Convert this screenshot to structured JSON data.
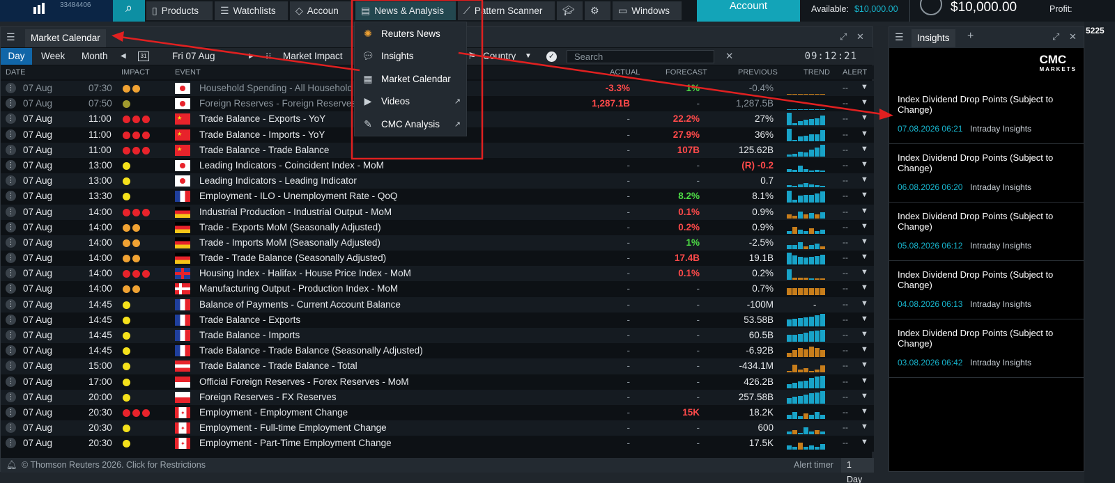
{
  "topnav": {
    "account_number": "33484406",
    "products": "Products",
    "watchlists": "Watchlists",
    "accounts": "Accoun",
    "news_analysis": "News & Analysis",
    "pattern_scanner": "Pattern Scanner",
    "windows": "Windows",
    "account": "Account",
    "available_label": "Available:",
    "available_value": "$10,000.00",
    "balance": "$10,000.00",
    "profit_label": "Profit:"
  },
  "dropdown": {
    "items": [
      {
        "label": "Reuters News",
        "icon": "reuters-icon"
      },
      {
        "label": "Insights",
        "icon": "insights-icon"
      },
      {
        "label": "Market Calendar",
        "icon": "calendar-icon"
      },
      {
        "label": "Videos",
        "icon": "video-icon",
        "external": true
      },
      {
        "label": "CMC Analysis",
        "icon": "pencil-icon",
        "external": true
      }
    ]
  },
  "calendar": {
    "tab": "Market Calendar",
    "views": [
      "Day",
      "Week",
      "Month"
    ],
    "date": "Fri 07 Aug",
    "date_icon_text": "31",
    "impact_filter": "Market Impact",
    "country_filter": "Country",
    "search_placeholder": "Search",
    "clock": "09:12:21",
    "columns": {
      "date": "DATE",
      "impact": "IMPACT",
      "event": "EVENT",
      "actual": "ACTUAL",
      "forecast": "FORECAST",
      "previous": "PREVIOUS",
      "trend": "TREND",
      "alert": "ALERT"
    },
    "footer": "© Thomson Reuters 2026. Click for Restrictions",
    "alert_timer": "Alert timer",
    "alert_timer_value": "1 Day ▲",
    "colors": {
      "high": "#e8232b",
      "medium": "#f0a233",
      "low": "#f5e11b",
      "low_dim": "#a09a2e",
      "trend_blue": "#18a3c8",
      "trend_orange": "#c77d1b"
    },
    "rows": [
      {
        "date": "07 Aug",
        "time": "07:30",
        "impact": [
          "medium",
          "medium"
        ],
        "flag": "jp",
        "event": "Household Spending - All Household Spending - YoY",
        "actual": "-3.3%",
        "actual_color": "red",
        "forecast": "1%",
        "forecast_color": "green",
        "previous": "-0.4%",
        "trend": [
          0,
          0,
          0,
          0,
          0,
          0,
          0
        ],
        "trend_colors": [
          "o",
          "o",
          "o",
          "o",
          "o",
          "o",
          "o"
        ],
        "alert": "--",
        "dim": true
      },
      {
        "date": "07 Aug",
        "time": "07:50",
        "impact": [
          "low_dim"
        ],
        "flag": "jp",
        "event": "Foreign Reserves - Foreign Reserves (USD)",
        "actual": "1,287.1B",
        "actual_color": "red",
        "forecast": "-",
        "forecast_color": "dash",
        "previous": "1,287.5B",
        "trend": [
          0,
          0,
          0,
          0,
          0,
          0,
          0
        ],
        "trend_colors": [
          "b",
          "b",
          "b",
          "b",
          "b",
          "b",
          "b"
        ],
        "alert": "--",
        "dim": true
      },
      {
        "date": "07 Aug",
        "time": "11:00",
        "impact": [
          "high",
          "high",
          "high"
        ],
        "flag": "cn",
        "event": "Trade Balance - Exports - YoY",
        "actual": "-",
        "actual_color": "dash",
        "forecast": "22.2%",
        "forecast_color": "red",
        "previous": "27%",
        "trend": [
          0.95,
          0.15,
          0.3,
          0.4,
          0.45,
          0.5,
          0.75
        ],
        "trend_colors": [
          "b",
          "b",
          "b",
          "b",
          "b",
          "b",
          "b"
        ],
        "alert": "--"
      },
      {
        "date": "07 Aug",
        "time": "11:00",
        "impact": [
          "high",
          "high",
          "high"
        ],
        "flag": "cn",
        "event": "Trade Balance - Imports - YoY",
        "actual": "-",
        "actual_color": "dash",
        "forecast": "27.9%",
        "forecast_color": "red",
        "previous": "36%",
        "trend": [
          0.95,
          0.1,
          0.35,
          0.4,
          0.55,
          0.5,
          0.85
        ],
        "trend_colors": [
          "b",
          "b",
          "b",
          "b",
          "b",
          "b",
          "b"
        ],
        "alert": "--"
      },
      {
        "date": "07 Aug",
        "time": "11:00",
        "impact": [
          "high",
          "high",
          "high"
        ],
        "flag": "cn",
        "event": "Trade Balance - Trade Balance",
        "actual": "-",
        "actual_color": "dash",
        "forecast": "107B",
        "forecast_color": "red",
        "previous": "125.62B",
        "trend": [
          0.15,
          0.2,
          0.35,
          0.3,
          0.5,
          0.7,
          0.9
        ],
        "trend_colors": [
          "b",
          "b",
          "b",
          "b",
          "b",
          "b",
          "b"
        ],
        "alert": "--"
      },
      {
        "date": "07 Aug",
        "time": "13:00",
        "impact": [
          "low"
        ],
        "flag": "jp",
        "event": "Leading Indicators - Coincident Index - MoM",
        "actual": "-",
        "actual_color": "dash",
        "forecast": "-",
        "forecast_color": "dash",
        "previous": "(R) -0.2",
        "previous_color": "red",
        "trend": [
          0.2,
          0.15,
          0.45,
          0.2,
          0.1,
          0.15,
          0.1
        ],
        "trend_colors": [
          "b",
          "b",
          "b",
          "b",
          "b",
          "b",
          "b"
        ],
        "alert": "--"
      },
      {
        "date": "07 Aug",
        "time": "13:00",
        "impact": [
          "low"
        ],
        "flag": "jp",
        "event": "Leading Indicators - Leading Indicator",
        "actual": "-",
        "actual_color": "dash",
        "forecast": "-",
        "forecast_color": "dash",
        "previous": "0.7",
        "trend": [
          0.15,
          0.1,
          0.2,
          0.3,
          0.2,
          0.15,
          0.1
        ],
        "trend_colors": [
          "b",
          "b",
          "b",
          "b",
          "b",
          "b",
          "b"
        ],
        "alert": "--"
      },
      {
        "date": "07 Aug",
        "time": "13:30",
        "impact": [
          "low"
        ],
        "flag": "fr",
        "event": "Employment - ILO - Unemployment Rate - QoQ",
        "actual": "-",
        "actual_color": "dash",
        "forecast": "8.2%",
        "forecast_color": "green",
        "previous": "8.1%",
        "trend": [
          0.9,
          0.2,
          0.5,
          0.6,
          0.6,
          0.7,
          0.85
        ],
        "trend_colors": [
          "b",
          "b",
          "b",
          "b",
          "b",
          "b",
          "b"
        ],
        "alert": "--"
      },
      {
        "date": "07 Aug",
        "time": "14:00",
        "impact": [
          "high",
          "high",
          "high"
        ],
        "flag": "de",
        "event": "Industrial Production - Industrial Output - MoM",
        "actual": "-",
        "actual_color": "dash",
        "forecast": "0.1%",
        "forecast_color": "red",
        "previous": "0.9%",
        "trend": [
          0.3,
          0.2,
          0.5,
          0.3,
          0.4,
          0.3,
          0.45
        ],
        "trend_colors": [
          "o",
          "o",
          "b",
          "o",
          "b",
          "o",
          "b"
        ],
        "alert": "--"
      },
      {
        "date": "07 Aug",
        "time": "14:00",
        "impact": [
          "medium",
          "medium"
        ],
        "flag": "de",
        "event": "Trade - Exports MoM (Seasonally Adjusted)",
        "actual": "-",
        "actual_color": "dash",
        "forecast": "0.2%",
        "forecast_color": "red",
        "previous": "0.9%",
        "trend": [
          0.2,
          0.5,
          0.3,
          0.2,
          0.4,
          0.2,
          0.3
        ],
        "trend_colors": [
          "b",
          "o",
          "b",
          "b",
          "o",
          "b",
          "b"
        ],
        "alert": "--"
      },
      {
        "date": "07 Aug",
        "time": "14:00",
        "impact": [
          "medium",
          "medium"
        ],
        "flag": "de",
        "event": "Trade - Imports MoM (Seasonally Adjusted)",
        "actual": "-",
        "actual_color": "dash",
        "forecast": "1%",
        "forecast_color": "green",
        "previous": "-2.5%",
        "trend": [
          0.3,
          0.3,
          0.5,
          0.2,
          0.3,
          0.4,
          0.2
        ],
        "trend_colors": [
          "b",
          "b",
          "b",
          "o",
          "b",
          "b",
          "o"
        ],
        "alert": "--"
      },
      {
        "date": "07 Aug",
        "time": "14:00",
        "impact": [
          "medium",
          "medium"
        ],
        "flag": "de",
        "event": "Trade - Trade Balance (Seasonally Adjusted)",
        "actual": "-",
        "actual_color": "dash",
        "forecast": "17.4B",
        "forecast_color": "red",
        "previous": "19.1B",
        "trend": [
          0.9,
          0.7,
          0.6,
          0.55,
          0.6,
          0.65,
          0.75
        ],
        "trend_colors": [
          "b",
          "b",
          "b",
          "b",
          "b",
          "b",
          "b"
        ],
        "alert": "--"
      },
      {
        "date": "07 Aug",
        "time": "14:00",
        "impact": [
          "high",
          "high",
          "high"
        ],
        "flag": "gb",
        "event": "Housing Index - Halifax - House Price Index - MoM",
        "actual": "-",
        "actual_color": "dash",
        "forecast": "0.1%",
        "forecast_color": "red",
        "previous": "0.2%",
        "trend": [
          0.8,
          0.15,
          0.15,
          0.15,
          0.1,
          0.1,
          0.1
        ],
        "trend_colors": [
          "b",
          "o",
          "o",
          "o",
          "b",
          "o",
          "o"
        ],
        "alert": "--"
      },
      {
        "date": "07 Aug",
        "time": "14:00",
        "impact": [
          "medium",
          "medium"
        ],
        "flag": "no",
        "event": "Manufacturing Output - Production Index - MoM",
        "actual": "-",
        "actual_color": "dash",
        "forecast": "-",
        "forecast_color": "dash",
        "previous": "0.7%",
        "trend": [
          0.55,
          0.55,
          0.55,
          0.55,
          0.55,
          0.5,
          0.55
        ],
        "trend_colors": [
          "o",
          "o",
          "o",
          "o",
          "o",
          "o",
          "o"
        ],
        "alert": "--"
      },
      {
        "date": "07 Aug",
        "time": "14:45",
        "impact": [
          "low"
        ],
        "flag": "fr",
        "event": "Balance of Payments - Current Account Balance",
        "actual": "-",
        "actual_color": "dash",
        "forecast": "-",
        "forecast_color": "dash",
        "previous": "-100M",
        "trend": [
          0,
          0,
          0,
          0,
          0,
          0,
          0
        ],
        "trend_colors": [
          "b",
          "b",
          "b",
          "b",
          "b",
          "b",
          "b"
        ],
        "alert": "--",
        "trend_mark": "-"
      },
      {
        "date": "07 Aug",
        "time": "14:45",
        "impact": [
          "low"
        ],
        "flag": "fr",
        "event": "Trade Balance - Exports",
        "actual": "-",
        "actual_color": "dash",
        "forecast": "-",
        "forecast_color": "dash",
        "previous": "53.58B",
        "trend": [
          0.5,
          0.6,
          0.65,
          0.7,
          0.75,
          0.85,
          0.95
        ],
        "trend_colors": [
          "b",
          "b",
          "b",
          "b",
          "b",
          "b",
          "b"
        ],
        "alert": "--"
      },
      {
        "date": "07 Aug",
        "time": "14:45",
        "impact": [
          "low"
        ],
        "flag": "fr",
        "event": "Trade Balance - Imports",
        "actual": "-",
        "actual_color": "dash",
        "forecast": "-",
        "forecast_color": "dash",
        "previous": "60.5B",
        "trend": [
          0.5,
          0.55,
          0.6,
          0.7,
          0.8,
          0.85,
          0.9
        ],
        "trend_colors": [
          "b",
          "b",
          "b",
          "b",
          "b",
          "b",
          "b"
        ],
        "alert": "--"
      },
      {
        "date": "07 Aug",
        "time": "14:45",
        "impact": [
          "low"
        ],
        "flag": "fr",
        "event": "Trade Balance - Trade Balance (Seasonally Adjusted)",
        "actual": "-",
        "actual_color": "dash",
        "forecast": "-",
        "forecast_color": "dash",
        "previous": "-6.92B",
        "trend": [
          0.3,
          0.5,
          0.7,
          0.6,
          0.8,
          0.7,
          0.5
        ],
        "trend_colors": [
          "o",
          "o",
          "o",
          "o",
          "o",
          "o",
          "o"
        ],
        "alert": "--"
      },
      {
        "date": "07 Aug",
        "time": "15:00",
        "impact": [
          "low"
        ],
        "flag": "at",
        "event": "Trade Balance - Trade Balance - Total",
        "actual": "-",
        "actual_color": "dash",
        "forecast": "-",
        "forecast_color": "dash",
        "previous": "-434.1M",
        "trend": [
          0.1,
          0.6,
          0.2,
          0.3,
          0.1,
          0.2,
          0.5
        ],
        "trend_colors": [
          "o",
          "o",
          "o",
          "o",
          "o",
          "o",
          "o"
        ],
        "alert": "--"
      },
      {
        "date": "07 Aug",
        "time": "17:00",
        "impact": [
          "low"
        ],
        "flag": "sg",
        "event": "Official Foreign Reserves - Forex Reserves - MoM",
        "actual": "-",
        "actual_color": "dash",
        "forecast": "-",
        "forecast_color": "dash",
        "previous": "426.2B",
        "trend": [
          0.3,
          0.4,
          0.5,
          0.6,
          0.8,
          0.9,
          0.95
        ],
        "trend_colors": [
          "b",
          "b",
          "b",
          "b",
          "b",
          "b",
          "b"
        ],
        "alert": "--"
      },
      {
        "date": "07 Aug",
        "time": "20:00",
        "impact": [
          "low"
        ],
        "flag": "pl",
        "event": "Foreign Reserves - FX Reserves",
        "actual": "-",
        "actual_color": "dash",
        "forecast": "-",
        "forecast_color": "dash",
        "previous": "257.58B",
        "trend": [
          0.4,
          0.55,
          0.6,
          0.7,
          0.8,
          0.85,
          0.95
        ],
        "trend_colors": [
          "b",
          "b",
          "b",
          "b",
          "b",
          "b",
          "b"
        ],
        "alert": "--"
      },
      {
        "date": "07 Aug",
        "time": "20:30",
        "impact": [
          "high",
          "high",
          "high"
        ],
        "flag": "ca",
        "event": "Employment - Employment Change",
        "actual": "-",
        "actual_color": "dash",
        "forecast": "15K",
        "forecast_color": "red",
        "previous": "18.2K",
        "trend": [
          0.3,
          0.5,
          0.2,
          0.4,
          0.3,
          0.5,
          0.3
        ],
        "trend_colors": [
          "b",
          "b",
          "b",
          "o",
          "b",
          "b",
          "b"
        ],
        "alert": "--"
      },
      {
        "date": "07 Aug",
        "time": "20:30",
        "impact": [
          "low"
        ],
        "flag": "ca",
        "event": "Employment - Full-time Employment Change",
        "actual": "-",
        "actual_color": "dash",
        "forecast": "-",
        "forecast_color": "dash",
        "previous": "600",
        "trend": [
          0.2,
          0.3,
          0.1,
          0.5,
          0.2,
          0.3,
          0.2
        ],
        "trend_colors": [
          "b",
          "o",
          "b",
          "b",
          "b",
          "o",
          "b"
        ],
        "alert": "--"
      },
      {
        "date": "07 Aug",
        "time": "20:30",
        "impact": [
          "low"
        ],
        "flag": "ca",
        "event": "Employment - Part-Time Employment Change",
        "actual": "-",
        "actual_color": "dash",
        "forecast": "-",
        "forecast_color": "dash",
        "previous": "17.5K",
        "trend": [
          0.3,
          0.2,
          0.5,
          0.2,
          0.3,
          0.2,
          0.4
        ],
        "trend_colors": [
          "b",
          "b",
          "o",
          "b",
          "b",
          "b",
          "b"
        ],
        "alert": "--"
      }
    ]
  },
  "insights": {
    "tab": "Insights",
    "logo_line1": "CMC",
    "logo_line2": "MARKETS",
    "cards": [
      {
        "title": "Index Dividend Drop Points (Subject to Change)",
        "date": "07.08.2026 06:21",
        "source": "Intraday Insights"
      },
      {
        "title": "Index Dividend Drop Points (Subject to Change)",
        "date": "06.08.2026 06:20",
        "source": "Intraday Insights"
      },
      {
        "title": "Index Dividend Drop Points (Subject to Change)",
        "date": "05.08.2026 06:12",
        "source": "Intraday Insights"
      },
      {
        "title": "Index Dividend Drop Points (Subject to Change)",
        "date": "04.08.2026 06:13",
        "source": "Intraday Insights"
      },
      {
        "title": "Index Dividend Drop Points (Subject to Change)",
        "date": "03.08.2026 06:42",
        "source": "Intraday Insights"
      }
    ]
  },
  "right_strip": {
    "value": "5225"
  }
}
